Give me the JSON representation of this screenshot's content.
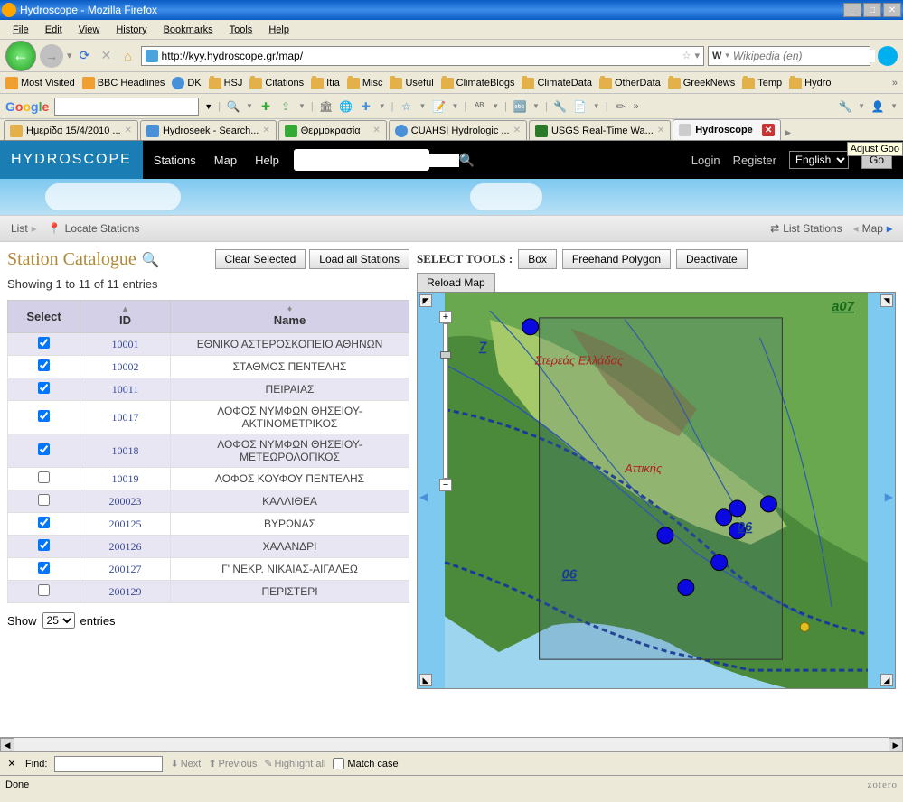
{
  "window": {
    "title": "Hydroscope - Mozilla Firefox",
    "adjust_tip": "Adjust Goo"
  },
  "menubar": [
    "File",
    "Edit",
    "View",
    "History",
    "Bookmarks",
    "Tools",
    "Help"
  ],
  "addr": {
    "url": "http://kyy.hydroscope.gr/map/"
  },
  "searchbox": {
    "engine": "W",
    "placeholder": "Wikipedia (en)"
  },
  "bookmarks": [
    "Most Visited",
    "BBC Headlines",
    "DK",
    "HSJ",
    "Citations",
    "Itia",
    "Misc",
    "Useful",
    "ClimateBlogs",
    "ClimateData",
    "OtherData",
    "GreekNews",
    "Temp",
    "Hydro"
  ],
  "google": {
    "label": "Google"
  },
  "tabs": [
    {
      "label": "Ημερίδα 15/4/2010 ..."
    },
    {
      "label": "Hydroseek - Search..."
    },
    {
      "label": "Θερμοκρασία"
    },
    {
      "label": "CUAHSI Hydrologic ..."
    },
    {
      "label": "USGS Real-Time Wa..."
    },
    {
      "label": "Hydroscope",
      "active": true
    }
  ],
  "hydro": {
    "logo": "HYDROSCOPE",
    "nav": [
      "Stations",
      "Map",
      "Help"
    ],
    "right": {
      "login": "Login",
      "register": "Register",
      "lang": "English",
      "go": "Go"
    }
  },
  "toolstrip": {
    "list": "List",
    "locate": "Locate Stations",
    "list_stations": "List Stations",
    "map": "Map"
  },
  "catalogue": {
    "title": "Station Catalogue",
    "btns": {
      "clear": "Clear Selected",
      "load": "Load all Stations"
    },
    "showing": "Showing 1 to 11 of 11 entries",
    "headers": {
      "select": "Select",
      "id": "ID",
      "name": "Name"
    },
    "rows": [
      {
        "checked": true,
        "id": "10001",
        "name": "ΕΘΝΙΚΟ ΑΣΤΕΡΟΣΚΟΠΕΙΟ ΑΘΗΝΩΝ"
      },
      {
        "checked": true,
        "id": "10002",
        "name": "ΣΤΑΘΜΟΣ ΠΕΝΤΕΛΗΣ"
      },
      {
        "checked": true,
        "id": "10011",
        "name": "ΠΕΙΡΑΙΑΣ"
      },
      {
        "checked": true,
        "id": "10017",
        "name": "ΛΟΦΟΣ ΝΥΜΦΩΝ ΘΗΣΕΙΟΥ-ΑΚΤΙΝΟΜΕΤΡΙΚΟΣ"
      },
      {
        "checked": true,
        "id": "10018",
        "name": "ΛΟΦΟΣ ΝΥΜΦΩΝ ΘΗΣΕΙΟΥ-ΜΕΤΕΩΡΟΛΟΓΙΚΟΣ"
      },
      {
        "checked": false,
        "id": "10019",
        "name": "ΛΟΦΟΣ ΚΟΥΦΟΥ ΠΕΝΤΕΛΗΣ"
      },
      {
        "checked": false,
        "id": "200023",
        "name": "ΚΑΛΛΙΘΕΑ"
      },
      {
        "checked": true,
        "id": "200125",
        "name": "ΒΥΡΩΝΑΣ"
      },
      {
        "checked": true,
        "id": "200126",
        "name": "ΧΑΛΑΝΔΡΙ"
      },
      {
        "checked": true,
        "id": "200127",
        "name": "Γ' ΝΕΚΡ. ΝΙΚΑΙΑΣ-ΑΙΓΑΛΕΩ"
      },
      {
        "checked": false,
        "id": "200129",
        "name": "ΠΕΡΙΣΤΕΡΙ"
      }
    ],
    "show_label": "Show",
    "entries_label": "entries",
    "entries_value": "25"
  },
  "select_tools": {
    "label": "SELECT TOOLS :",
    "box": "Box",
    "freehand": "Freehand Polygon",
    "deactivate": "Deactivate",
    "reload": "Reload Map"
  },
  "map": {
    "region1": "Στερεάς Ελλάδας",
    "region2": "Αττικής",
    "code_a07": "a07",
    "code_06": "06",
    "code_7": "7"
  },
  "findbar": {
    "label": "Find:",
    "next": "Next",
    "prev": "Previous",
    "highlight": "Highlight all",
    "match": "Match case"
  },
  "status": {
    "text": "Done",
    "zotero": "zotero"
  }
}
